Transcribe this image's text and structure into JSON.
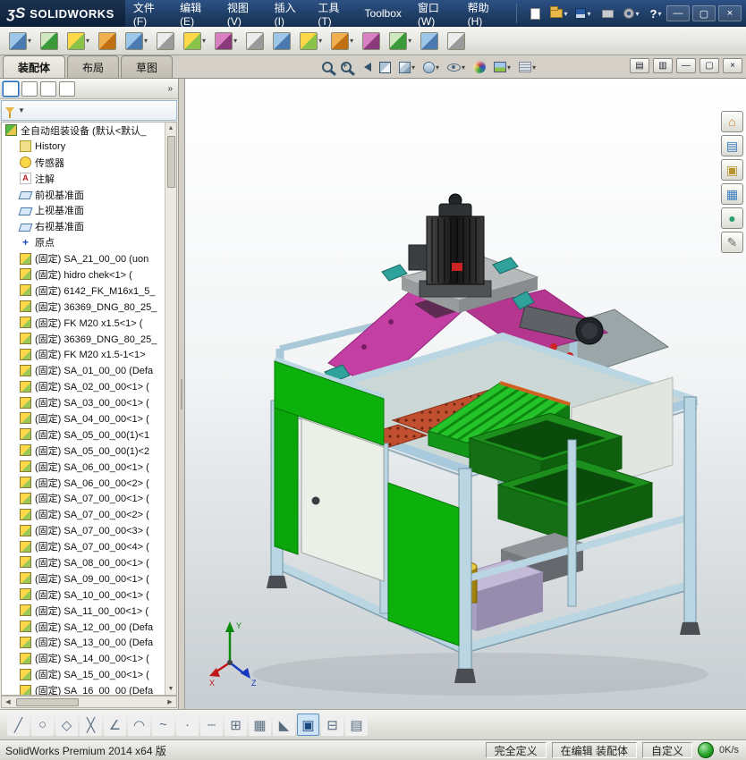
{
  "colors": {
    "titlebar": "#1d3b63",
    "frame_blue": "#b9d6e2",
    "panel_green": "#0cb10c",
    "magenta_plate": "#c43fa4",
    "orange_plate": "#c05030",
    "bin_green": "#157015",
    "accent_blue": "#5a92c8"
  },
  "titlebar": {
    "logo_mark": "ʒS",
    "logo_text": "SOLIDWORKS",
    "menus": [
      {
        "name": "menu-file",
        "label": "文件(F)"
      },
      {
        "name": "menu-edit",
        "label": "编辑(E)"
      },
      {
        "name": "menu-view",
        "label": "视图(V)"
      },
      {
        "name": "menu-insert",
        "label": "插入(I)"
      },
      {
        "name": "menu-tools",
        "label": "工具(T)"
      },
      {
        "name": "menu-toolbox",
        "label": "Toolbox"
      },
      {
        "name": "menu-window",
        "label": "窗口(W)"
      },
      {
        "name": "menu-help",
        "label": "帮助(H)"
      }
    ],
    "quick_tools": [
      {
        "name": "new-document-button",
        "icon": "qi-new"
      },
      {
        "name": "open-document-button",
        "icon": "qi-open",
        "caret": "on"
      },
      {
        "name": "save-button",
        "icon": "qi-save",
        "caret": "on"
      },
      {
        "name": "print-button",
        "icon": "qi-print"
      },
      {
        "name": "options-button",
        "icon": "qi-gear",
        "caret": "on"
      },
      {
        "name": "help-button",
        "icon": "qi-help",
        "glyph": "?",
        "caret": "on"
      }
    ],
    "window_controls": [
      {
        "name": "minimize-app-button",
        "glyph": "—"
      },
      {
        "name": "restore-app-button",
        "glyph": "▢"
      },
      {
        "name": "close-app-button",
        "glyph": "×"
      }
    ]
  },
  "toolbar": {
    "items": [
      {
        "name": "insert-components-button",
        "icon": "ic-v2",
        "caret": "on"
      },
      {
        "name": "mate-button",
        "icon": "ic-v3"
      },
      {
        "name": "linear-component-pattern-button",
        "icon": "ic-v1",
        "caret": "on"
      },
      {
        "name": "smart-fasteners-button",
        "icon": "ic-v5"
      },
      {
        "name": "move-component-button",
        "icon": "ic-v2",
        "caret": "on"
      },
      {
        "name": "show-hidden-components-button",
        "icon": "ic-v4"
      },
      {
        "name": "assembly-features-button",
        "icon": "ic-v1",
        "caret": "on"
      },
      {
        "name": "reference-geometry-button",
        "icon": "ic-v6",
        "caret": "on"
      },
      {
        "name": "belt-chain-button",
        "icon": "ic-v4"
      },
      {
        "name": "new-motion-study-button",
        "icon": "ic-v2"
      },
      {
        "name": "bill-of-materials-button",
        "icon": "ic-v1",
        "caret": "on"
      },
      {
        "name": "exploded-view-button",
        "icon": "ic-v5",
        "caret": "on"
      },
      {
        "name": "explode-line-sketch-button",
        "icon": "ic-v6"
      },
      {
        "name": "interference-detection-button",
        "icon": "ic-v3",
        "caret": "on"
      },
      {
        "name": "instant3d-button",
        "icon": "ic-v2"
      },
      {
        "name": "large-assembly-mode-button",
        "icon": "ic-v4"
      }
    ]
  },
  "tabs": [
    {
      "name": "tab-assembly",
      "label": "装配体",
      "state": "active"
    },
    {
      "name": "tab-layout",
      "label": "布局"
    },
    {
      "name": "tab-sketch",
      "label": "草图"
    }
  ],
  "headsup": [
    {
      "name": "zoom-to-fit-icon",
      "icon": "hu-zoomfit"
    },
    {
      "name": "zoom-to-area-icon",
      "icon": "hu-zoomarea"
    },
    {
      "name": "previous-view-icon",
      "icon": "hu-prev"
    },
    {
      "name": "section-view-icon",
      "icon": "hu-section"
    },
    {
      "name": "view-orientation-icon",
      "icon": "hu-cube",
      "caret": "on"
    },
    {
      "name": "display-style-icon",
      "icon": "hu-style",
      "caret": "on"
    },
    {
      "name": "hide-show-items-icon",
      "icon": "hu-eye",
      "caret": "on"
    },
    {
      "name": "edit-appearance-icon",
      "icon": "hu-ball"
    },
    {
      "name": "apply-scene-icon",
      "icon": "hu-scene",
      "caret": "on"
    },
    {
      "name": "view-settings-icon",
      "icon": "hu-settings",
      "caret": "on"
    }
  ],
  "docwin": [
    {
      "name": "tile-windows-button",
      "glyph": "▤"
    },
    {
      "name": "cascade-windows-button",
      "glyph": "▥"
    },
    {
      "name": "minimize-document-button",
      "glyph": "—"
    },
    {
      "name": "restore-document-button",
      "glyph": "▢"
    },
    {
      "name": "close-document-button",
      "glyph": "×"
    }
  ],
  "panel": {
    "overflow": "»",
    "tabs": [
      {
        "name": "featuremanager-tab",
        "icon": "pt1",
        "state": "sel"
      },
      {
        "name": "propertymanager-tab",
        "icon": "pt2"
      },
      {
        "name": "configurationmanager-tab",
        "icon": "pt3"
      },
      {
        "name": "displaymanager-tab",
        "icon": "pt4"
      }
    ]
  },
  "tree": {
    "root": "全自动组装设备 (默认<默认_",
    "items": [
      {
        "icon": "i-hist",
        "label": "History"
      },
      {
        "icon": "i-sensor",
        "label": "传感器"
      },
      {
        "icon": "i-ann",
        "label": "注解"
      },
      {
        "icon": "i-plane",
        "label": "前视基准面"
      },
      {
        "icon": "i-plane",
        "label": "上视基准面"
      },
      {
        "icon": "i-plane",
        "label": "右视基准面"
      },
      {
        "icon": "i-origin",
        "label": "原点"
      },
      {
        "icon": "i-comp",
        "label": "(固定) SA_21_00_00 (uon"
      },
      {
        "icon": "i-comp",
        "label": "(固定) hidro chek<1> ("
      },
      {
        "icon": "i-comp",
        "label": "(固定) 6142_FK_M16x1_5_"
      },
      {
        "icon": "i-comp",
        "label": "(固定) 36369_DNG_80_25_"
      },
      {
        "icon": "i-comp",
        "label": "(固定) FK M20 x1.5<1> ("
      },
      {
        "icon": "i-comp",
        "label": "(固定) 36369_DNG_80_25_"
      },
      {
        "icon": "i-comp",
        "label": "(固定) FK M20 x1.5-1<1>"
      },
      {
        "icon": "i-comp",
        "label": "(固定) SA_01_00_00 (Defa"
      },
      {
        "icon": "i-comp",
        "label": "(固定) SA_02_00_00<1> ("
      },
      {
        "icon": "i-comp",
        "label": "(固定) SA_03_00_00<1> ("
      },
      {
        "icon": "i-comp",
        "label": "(固定) SA_04_00_00<1> ("
      },
      {
        "icon": "i-comp",
        "label": "(固定) SA_05_00_00(1)<1"
      },
      {
        "icon": "i-comp",
        "label": "(固定) SA_05_00_00(1)<2"
      },
      {
        "icon": "i-comp",
        "label": "(固定) SA_06_00_00<1> ("
      },
      {
        "icon": "i-comp",
        "label": "(固定) SA_06_00_00<2> ("
      },
      {
        "icon": "i-comp",
        "label": "(固定) SA_07_00_00<1> ("
      },
      {
        "icon": "i-comp",
        "label": "(固定) SA_07_00_00<2> ("
      },
      {
        "icon": "i-comp",
        "label": "(固定) SA_07_00_00<3> ("
      },
      {
        "icon": "i-comp",
        "label": "(固定) SA_07_00_00<4> ("
      },
      {
        "icon": "i-comp",
        "label": "(固定) SA_08_00_00<1> ("
      },
      {
        "icon": "i-comp",
        "label": "(固定) SA_09_00_00<1> ("
      },
      {
        "icon": "i-comp",
        "label": "(固定) SA_10_00_00<1> ("
      },
      {
        "icon": "i-comp",
        "label": "(固定) SA_11_00_00<1> ("
      },
      {
        "icon": "i-comp",
        "label": "(固定) SA_12_00_00 (Defa"
      },
      {
        "icon": "i-comp",
        "label": "(固定) SA_13_00_00 (Defa"
      },
      {
        "icon": "i-comp",
        "label": "(固定) SA_14_00_00<1> ("
      },
      {
        "icon": "i-comp",
        "label": "(固定) SA_15_00_00<1> ("
      },
      {
        "icon": "i-comp",
        "label": "(固定) SA_16_00_00 (Defa"
      }
    ]
  },
  "taskpane": [
    {
      "name": "home-tab",
      "glyph": "⌂",
      "cls": "c-orange"
    },
    {
      "name": "design-library-tab",
      "glyph": "▤",
      "cls": "c-blue"
    },
    {
      "name": "file-explorer-tab",
      "glyph": "▣",
      "cls": "c-yellow"
    },
    {
      "name": "view-palette-tab",
      "glyph": "▦",
      "cls": "c-blue"
    },
    {
      "name": "appearances-scenes-tab",
      "glyph": "●",
      "cls": "c-green"
    },
    {
      "name": "custom-properties-tab",
      "glyph": "✎",
      "cls": "c-gray"
    }
  ],
  "sketchbar": [
    {
      "name": "sketch-line-button",
      "glyph": "╱"
    },
    {
      "name": "sketch-circle-button",
      "glyph": "○"
    },
    {
      "name": "sketch-ellipse-button",
      "glyph": "◇"
    },
    {
      "name": "sketch-trim-button",
      "glyph": "╳"
    },
    {
      "name": "sketch-chamfer-button",
      "glyph": "∠"
    },
    {
      "name": "sketch-arc-button",
      "glyph": "◠"
    },
    {
      "name": "sketch-spline-button",
      "glyph": "~"
    },
    {
      "name": "sketch-point-button",
      "glyph": "·"
    },
    {
      "name": "sketch-centerline-button",
      "glyph": "┄"
    },
    {
      "name": "grid-display-button",
      "glyph": "⊞"
    },
    {
      "name": "sketch-pattern-button",
      "glyph": "▦"
    },
    {
      "name": "snap-button",
      "glyph": "◣"
    },
    {
      "name": "sketch-mode-button",
      "glyph": "▣",
      "state": "active"
    },
    {
      "name": "section-grid-button",
      "glyph": "⊟"
    },
    {
      "name": "design-table-button",
      "glyph": "▤"
    }
  ],
  "statusbar": {
    "product": "SolidWorks Premium 2014 x64 版",
    "defined": "完全定义",
    "editing": "在编辑 装配体",
    "custom": "自定义",
    "net_speed": "0K/s"
  }
}
